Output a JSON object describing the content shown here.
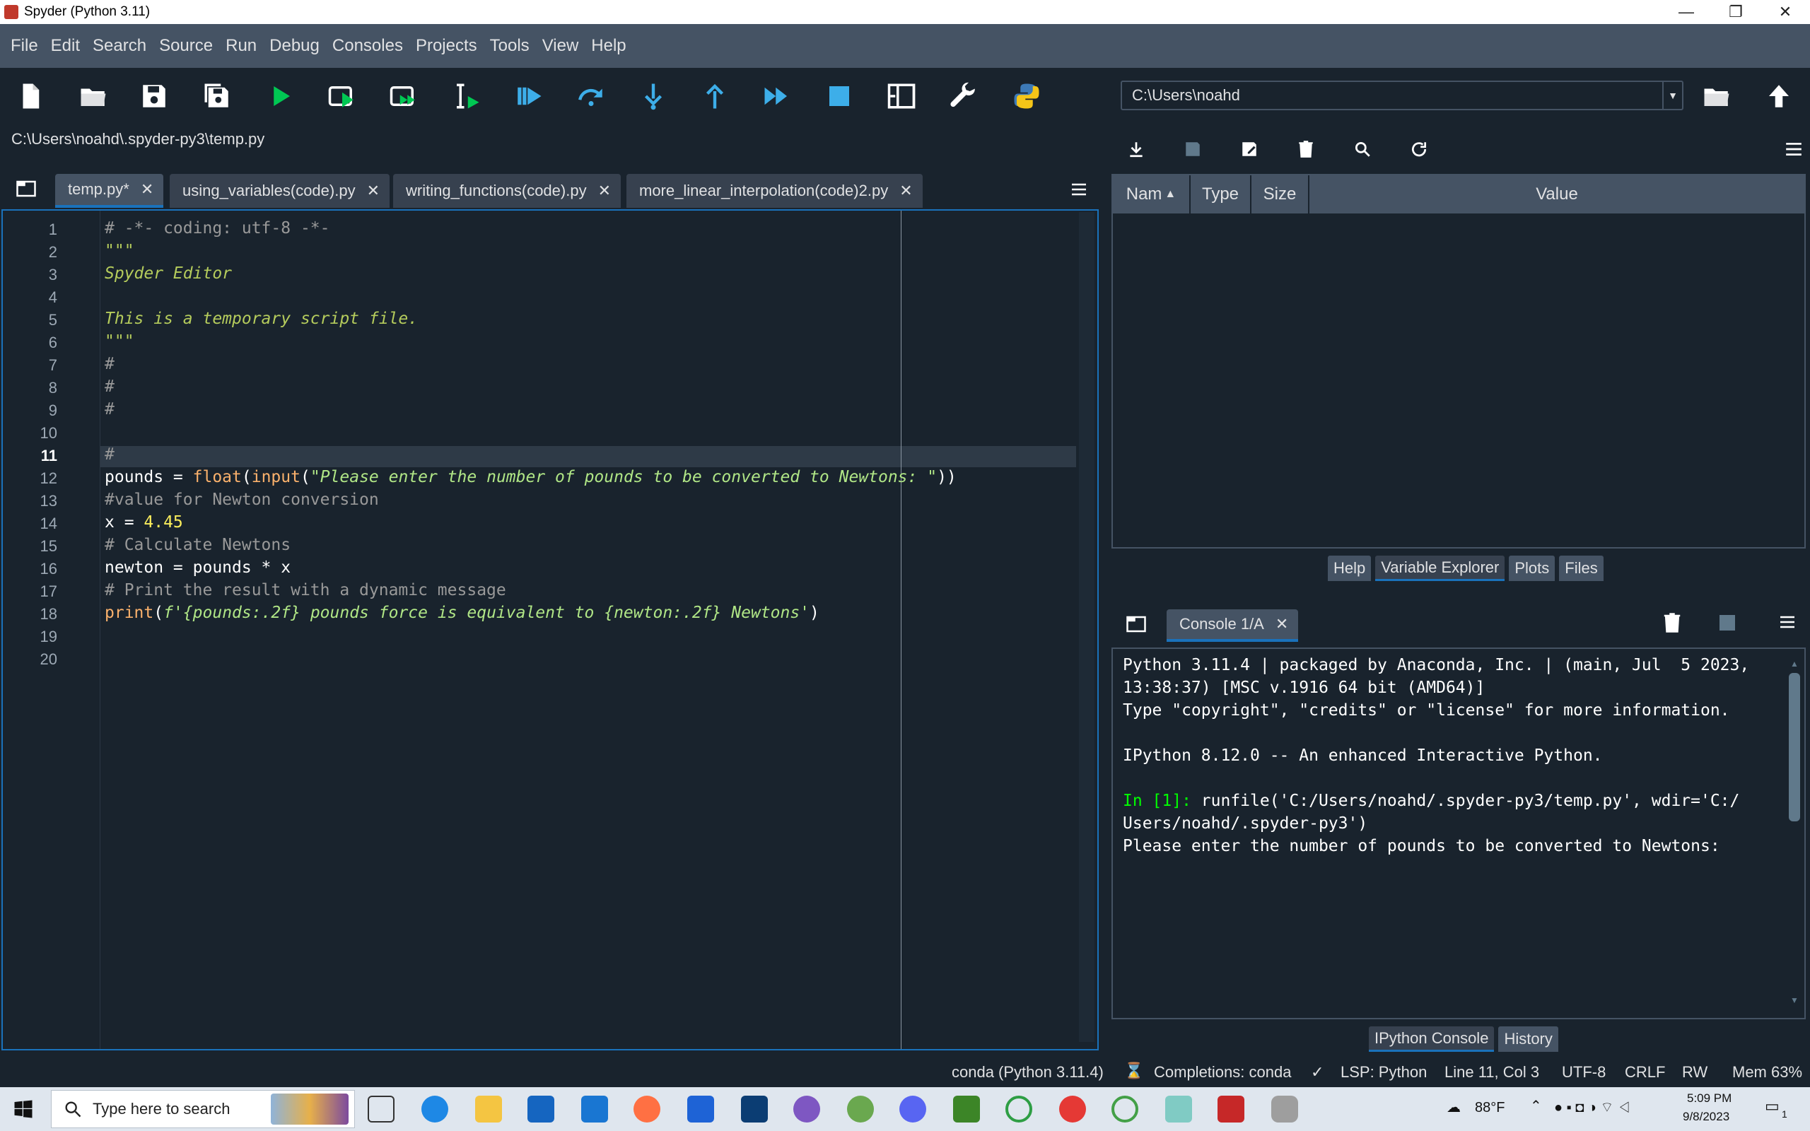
{
  "window": {
    "title": "Spyder (Python 3.11)",
    "minimize": "—",
    "maximize": "❐",
    "close": "✕"
  },
  "menubar": [
    "File",
    "Edit",
    "Search",
    "Source",
    "Run",
    "Debug",
    "Consoles",
    "Projects",
    "Tools",
    "View",
    "Help"
  ],
  "toolbar": {
    "buttons": [
      "new-file",
      "open-file",
      "save-file",
      "save-all",
      "run",
      "run-cell",
      "run-cell-advance",
      "run-selection",
      "debug",
      "step",
      "step-into",
      "step-return",
      "continue",
      "stop",
      "maximize-pane",
      "preferences",
      "python-path-manager"
    ],
    "working_directory": "C:\\Users\\noahd"
  },
  "editor": {
    "file_path": "C:\\Users\\noahd\\.spyder-py3\\temp.py",
    "tabs": [
      {
        "label": "temp.py*",
        "active": true
      },
      {
        "label": "using_variables(code).py",
        "active": false
      },
      {
        "label": "writing_functions(code).py",
        "active": false
      },
      {
        "label": "more_linear_interpolation(code)2.py",
        "active": false
      }
    ],
    "close_glyph": "✕",
    "current_line": 11,
    "line_numbers": [
      "1",
      "2",
      "3",
      "4",
      "5",
      "6",
      "7",
      "8",
      "9",
      "10",
      "11",
      "12",
      "13",
      "14",
      "15",
      "16",
      "17",
      "18",
      "19",
      "20"
    ],
    "lines": {
      "l1": "# -*- coding: utf-8 -*-",
      "l2": "\"\"\"",
      "l3": "Spyder Editor",
      "l5": "This is a temporary script file.",
      "l6": "\"\"\"",
      "l7": "#",
      "l8": "#",
      "l9": "#",
      "l11": "#",
      "l12a": "pounds = ",
      "l12b": "float",
      "l12c": "(",
      "l12d": "input",
      "l12e": "(",
      "l12f": "\"Please enter the number of pounds to be converted to Newtons: \"",
      "l12g": "))",
      "l13": "#value for Newton conversion",
      "l14a": "x = ",
      "l14b": "4.45",
      "l15": "# Calculate Newtons",
      "l16": "newton = pounds * x",
      "l17": "# Print the result with a dynamic message",
      "l18a": "print",
      "l18b": "(",
      "l18c": "f'{pounds:.2f} pounds force is equivalent to {newton:.2f} Newtons'",
      "l18d": ")"
    }
  },
  "variable_explorer": {
    "columns": [
      "Nam",
      "Type",
      "Size",
      "Value"
    ],
    "sort_glyph": "▲",
    "tabs": [
      {
        "label": "Help",
        "active": false
      },
      {
        "label": "Variable Explorer",
        "active": true
      },
      {
        "label": "Plots",
        "active": false
      },
      {
        "label": "Files",
        "active": false
      }
    ]
  },
  "console": {
    "tab_label": "Console 1/A",
    "close_glyph": "✕",
    "lines": {
      "c1": "Python 3.11.4 | packaged by Anaconda, Inc. | (main, Jul  5 2023,",
      "c2": "13:38:37) [MSC v.1916 64 bit (AMD64)]",
      "c3": "Type \"copyright\", \"credits\" or \"license\" for more information.",
      "c4": "IPython 8.12.0 -- An enhanced Interactive Python.",
      "c5_prompt": "In [1]:",
      "c5_cmd": " runfile('C:/Users/noahd/.spyder-py3/temp.py', wdir='C:/",
      "c6": "Users/noahd/.spyder-py3')",
      "c7": "Please enter the number of pounds to be converted to Newtons:"
    },
    "tabs": [
      {
        "label": "IPython Console",
        "active": true
      },
      {
        "label": "History",
        "active": false
      }
    ]
  },
  "statusbar": {
    "env": "conda (Python 3.11.4)",
    "completions": "Completions: conda",
    "lsp": "LSP: Python",
    "position": "Line 11, Col 3",
    "encoding": "UTF-8",
    "eol": "CRLF",
    "rw": "RW",
    "mem": "Mem 63%"
  },
  "taskbar": {
    "search_placeholder": "Type here to search",
    "weather": "88°F",
    "time": "5:09 PM",
    "date": "9/8/2023",
    "notifications": "1"
  },
  "colors": {
    "background": "#19232d",
    "panel": "#455364",
    "accent": "#1a72bb",
    "run_green": "#00c853"
  }
}
